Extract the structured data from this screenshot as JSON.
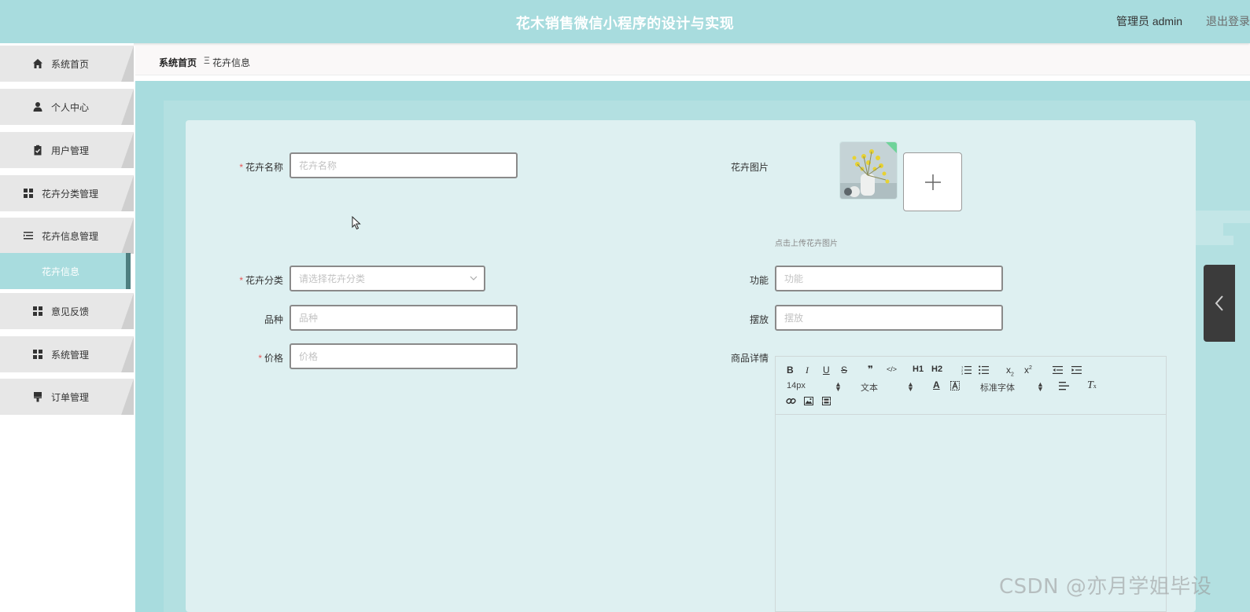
{
  "header": {
    "title": "花木销售微信小程序的设计与实现",
    "user_label": "管理员 admin",
    "logout_label": "退出登录"
  },
  "sidebar": {
    "items": [
      {
        "label": "系统首页",
        "icon": "home-icon"
      },
      {
        "label": "个人中心",
        "icon": "user-icon"
      },
      {
        "label": "用户管理",
        "icon": "clipboard-icon"
      },
      {
        "label": "花卉分类管理",
        "icon": "grid-icon"
      },
      {
        "label": "花卉信息管理",
        "icon": "list-icon"
      },
      {
        "label": "花卉信息",
        "icon": ""
      },
      {
        "label": "意见反馈",
        "icon": "grid-icon"
      },
      {
        "label": "系统管理",
        "icon": "grid-icon"
      },
      {
        "label": "订单管理",
        "icon": "brush-icon"
      }
    ],
    "active_index": 5
  },
  "breadcrumb": {
    "home": "系统首页",
    "separator": "Ξ",
    "current": "花卉信息"
  },
  "form": {
    "name": {
      "label": "花卉名称",
      "placeholder": "花卉名称",
      "required": true
    },
    "image": {
      "label": "花卉图片",
      "hint": "点击上传花卉图片"
    },
    "category": {
      "label": "花卉分类",
      "placeholder": "请选择花卉分类",
      "required": true
    },
    "function": {
      "label": "功能",
      "placeholder": "功能"
    },
    "variety": {
      "label": "品种",
      "placeholder": "品种"
    },
    "placement": {
      "label": "摆放",
      "placeholder": "摆放"
    },
    "price": {
      "label": "价格",
      "placeholder": "价格",
      "required": true
    },
    "details": {
      "label": "商品详情"
    }
  },
  "editor": {
    "font_size": "14px",
    "block_type": "文本",
    "font_family": "标准字体",
    "buttons": [
      "B",
      "I",
      "U",
      "S",
      "❞",
      "</>",
      "H1",
      "H2",
      "ordered-list",
      "bullet-list",
      "x2",
      "x2",
      "outdent",
      "indent"
    ]
  },
  "watermark": "CSDN @亦月学姐毕设",
  "colors": {
    "header_bg": "#a8dcde",
    "card_bg": "#def0f1",
    "active_menu": "#a8dcde",
    "required": "#e45656"
  }
}
